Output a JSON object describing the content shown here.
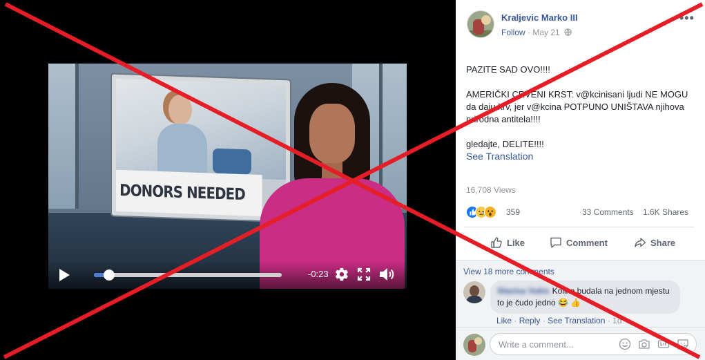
{
  "video": {
    "caption": "DONORS NEEDED",
    "time_remaining": "-0:23",
    "progress": 0.08
  },
  "post": {
    "author": "Kraljevic Marko III",
    "follow_label": "Follow",
    "meta_separator": " · ",
    "date": "May 21",
    "menu_label": "•••",
    "paragraphs": [
      "PAZITE SAD OVO!!!!",
      "AMERIČKI CRVENI KRST: v@kcinisani ljudi NE MOGU da daju krv, jer v@kcina POTPUNO UNIŠTAVA njihova prirodna antitela!!!!",
      "gledajte, DELITE!!!!"
    ],
    "see_translation": "See Translation",
    "views": "16,708 Views",
    "reactions_count": "359",
    "comments_count": "33 Comments",
    "shares_count": "1.6K Shares",
    "actions": {
      "like": "Like",
      "comment": "Comment",
      "share": "Share"
    }
  },
  "comments": {
    "view_more": "View 18 more comments",
    "items": [
      {
        "author": "Slavisa Vukic",
        "text": "Koliko budala na jednom mjestu to je čudo jedno 😂 👍",
        "like_label": "Like",
        "reply_label": "Reply",
        "see_translation": "See Translation",
        "age": "1d"
      }
    ],
    "composer_placeholder": "Write a comment..."
  },
  "colors": {
    "link_blue": "#385898",
    "cross_red": "#e51d26",
    "dress_pink": "#c92d84"
  },
  "icons": {
    "play": "play-icon",
    "settings": "gear-icon",
    "fullscreen": "fullscreen-icon",
    "volume": "speaker-icon",
    "globe": "globe-icon",
    "like": "thumbs-up-icon",
    "comment": "speech-bubble-icon",
    "share": "share-arrow-icon"
  }
}
